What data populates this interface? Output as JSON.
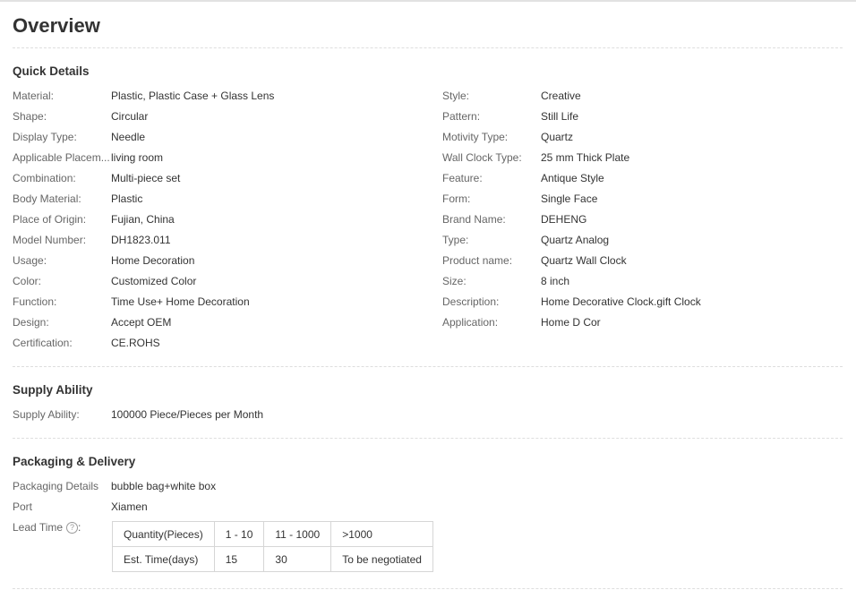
{
  "page": {
    "title": "Overview"
  },
  "quick_details": {
    "heading": "Quick Details",
    "left": [
      {
        "label": "Material:",
        "value": "Plastic, Plastic Case + Glass Lens"
      },
      {
        "label": "Shape:",
        "value": "Circular"
      },
      {
        "label": "Display Type:",
        "value": "Needle"
      },
      {
        "label": "Applicable Placem...",
        "value": "living room"
      },
      {
        "label": "Combination:",
        "value": "Multi-piece set"
      },
      {
        "label": "Body Material:",
        "value": "Plastic"
      },
      {
        "label": "Place of Origin:",
        "value": "Fujian, China"
      },
      {
        "label": "Model Number:",
        "value": "DH1823.011"
      },
      {
        "label": "Usage:",
        "value": "Home Decoration"
      },
      {
        "label": "Color:",
        "value": "Customized Color"
      },
      {
        "label": "Function:",
        "value": "Time Use+ Home Decoration"
      },
      {
        "label": "Design:",
        "value": "Accept OEM"
      },
      {
        "label": "Certification:",
        "value": "CE.ROHS"
      }
    ],
    "right": [
      {
        "label": "Style:",
        "value": "Creative"
      },
      {
        "label": "Pattern:",
        "value": "Still Life"
      },
      {
        "label": "Motivity Type:",
        "value": "Quartz"
      },
      {
        "label": "Wall Clock Type:",
        "value": "25 mm Thick Plate"
      },
      {
        "label": "Feature:",
        "value": "Antique Style"
      },
      {
        "label": "Form:",
        "value": "Single Face"
      },
      {
        "label": "Brand Name:",
        "value": "DEHENG"
      },
      {
        "label": "Type:",
        "value": "Quartz Analog"
      },
      {
        "label": "Product name:",
        "value": "Quartz Wall Clock"
      },
      {
        "label": "Size:",
        "value": "8 inch"
      },
      {
        "label": "Description:",
        "value": "Home Decorative Clock.gift Clock"
      },
      {
        "label": "Application:",
        "value": "Home D Cor"
      }
    ]
  },
  "supply": {
    "heading": "Supply Ability",
    "label": "Supply Ability:",
    "value": "100000 Piece/Pieces per Month"
  },
  "packaging": {
    "heading": "Packaging & Delivery",
    "details_label": "Packaging Details",
    "details_value": "bubble bag+white box",
    "port_label": "Port",
    "port_value": "Xiamen",
    "lead_time_label": "Lead Time",
    "help_icon": "question-circle-icon",
    "lead_table": {
      "rows": [
        [
          "Quantity(Pieces)",
          "1 - 10",
          "11 - 1000",
          ">1000"
        ],
        [
          "Est. Time(days)",
          "15",
          "30",
          "To be negotiated"
        ]
      ]
    }
  }
}
